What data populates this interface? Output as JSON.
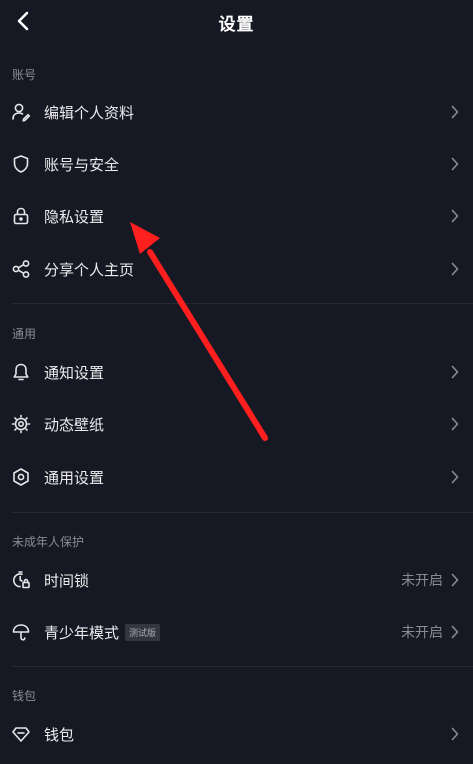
{
  "header": {
    "title": "设置",
    "back_icon": "chevron-left-icon"
  },
  "sections": {
    "account": {
      "label": "账号",
      "items": [
        {
          "label": "编辑个人资料",
          "icon": "user-edit-icon"
        },
        {
          "label": "账号与安全",
          "icon": "shield-icon"
        },
        {
          "label": "隐私设置",
          "icon": "lock-icon"
        },
        {
          "label": "分享个人主页",
          "icon": "share-icon"
        }
      ]
    },
    "general": {
      "label": "通用",
      "items": [
        {
          "label": "通知设置",
          "icon": "bell-icon"
        },
        {
          "label": "动态壁纸",
          "icon": "wallpaper-icon"
        },
        {
          "label": "通用设置",
          "icon": "hexagon-settings-icon"
        }
      ]
    },
    "minor": {
      "label": "未成年人保护",
      "items": [
        {
          "label": "时间锁",
          "icon": "timer-lock-icon",
          "status": "未开启"
        },
        {
          "label": "青少年模式",
          "icon": "umbrella-icon",
          "status": "未开启",
          "badge": "测试版"
        }
      ]
    },
    "wallet": {
      "label": "钱包",
      "items": [
        {
          "label": "钱包",
          "icon": "diamond-icon"
        }
      ]
    }
  },
  "colors": {
    "background": "#161823",
    "text": "#ececee",
    "muted": "#8a8b91",
    "annotation_arrow": "#ff1f1f"
  }
}
